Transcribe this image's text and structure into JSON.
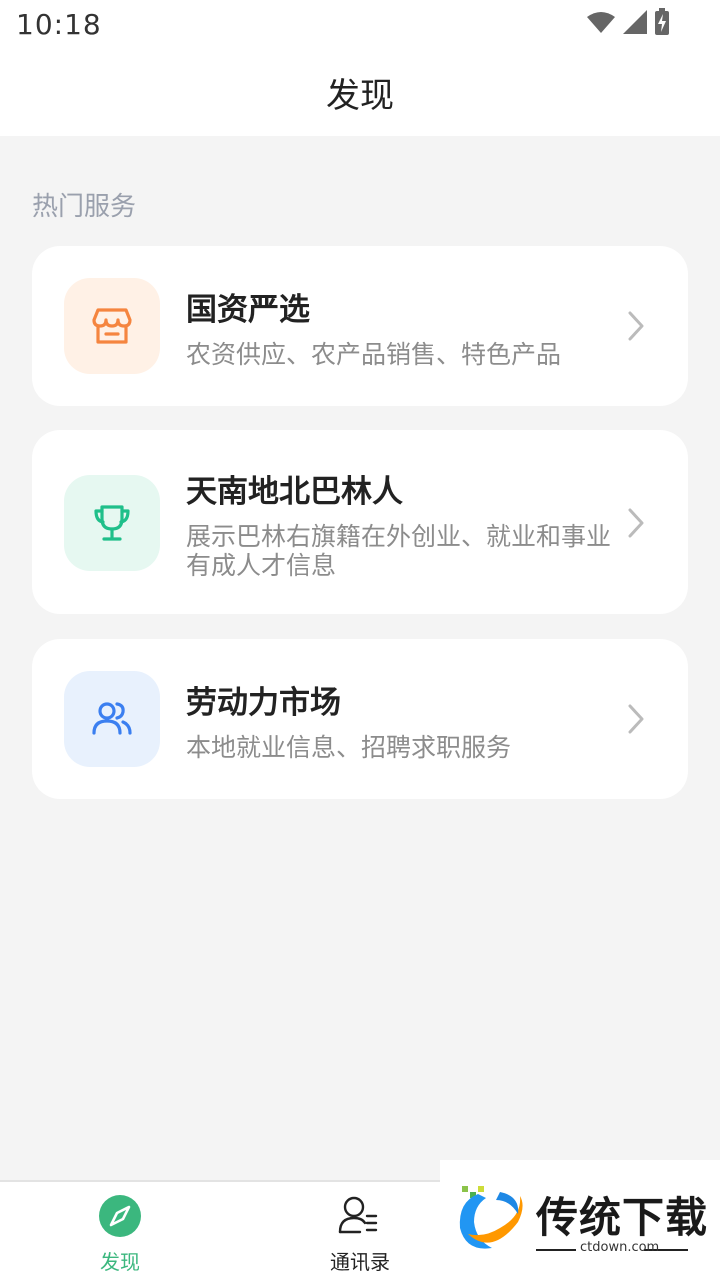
{
  "status_bar": {
    "time": "10:18"
  },
  "header": {
    "title": "发现"
  },
  "section": {
    "title": "热门服务"
  },
  "cards": [
    {
      "title": "国资严选",
      "desc": "农资供应、农产品销售、特色产品",
      "icon": "shop-icon",
      "icon_color": "#f5853f",
      "icon_bg": "#fff1e6"
    },
    {
      "title": "天南地北巴林人",
      "desc": "展示巴林右旗籍在外创业、就业和事业有成人才信息",
      "icon": "trophy-icon",
      "icon_color": "#1fbf8a",
      "icon_bg": "#e6f8f1"
    },
    {
      "title": "劳动力市场",
      "desc": "本地就业信息、招聘求职服务",
      "icon": "users-icon",
      "icon_color": "#3b7ff0",
      "icon_bg": "#e8f1fd"
    }
  ],
  "tab_bar": {
    "tabs": [
      {
        "label": "发现",
        "icon": "compass-icon",
        "active": true
      },
      {
        "label": "通讯录",
        "icon": "contacts-icon",
        "active": false
      }
    ],
    "active_color": "#3bb77e",
    "inactive_color": "#222222"
  },
  "watermark": {
    "text": "传统下载",
    "sub": "ctdown.com"
  }
}
